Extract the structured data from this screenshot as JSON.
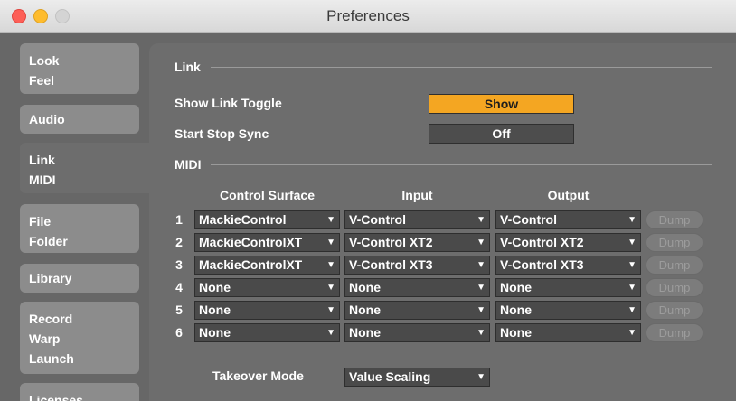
{
  "window": {
    "title": "Preferences"
  },
  "sidebar": {
    "items": [
      {
        "lines": [
          "Look",
          "Feel"
        ]
      },
      {
        "lines": [
          "Audio"
        ]
      },
      {
        "lines": [
          "Link",
          "MIDI"
        ],
        "active": true
      },
      {
        "lines": [
          "File",
          "Folder"
        ]
      },
      {
        "lines": [
          "Library"
        ]
      },
      {
        "lines": [
          "Record",
          "Warp",
          "Launch"
        ]
      },
      {
        "lines": [
          "Licenses"
        ]
      }
    ]
  },
  "link": {
    "title": "Link",
    "show_link_toggle": {
      "label": "Show Link Toggle",
      "value": "Show",
      "state": "on"
    },
    "start_stop_sync": {
      "label": "Start Stop Sync",
      "value": "Off",
      "state": "off"
    }
  },
  "midi": {
    "title": "MIDI",
    "headers": {
      "control_surface": "Control Surface",
      "input": "Input",
      "output": "Output"
    },
    "dump_label": "Dump",
    "rows": [
      {
        "num": "1",
        "control_surface": "MackieControl",
        "input": "V-Control",
        "output": "V-Control"
      },
      {
        "num": "2",
        "control_surface": "MackieControlXT",
        "input": "V-Control XT2",
        "output": "V-Control XT2"
      },
      {
        "num": "3",
        "control_surface": "MackieControlXT",
        "input": "V-Control XT3",
        "output": "V-Control XT3"
      },
      {
        "num": "4",
        "control_surface": "None",
        "input": "None",
        "output": "None"
      },
      {
        "num": "5",
        "control_surface": "None",
        "input": "None",
        "output": "None"
      },
      {
        "num": "6",
        "control_surface": "None",
        "input": "None",
        "output": "None"
      }
    ],
    "takeover": {
      "label": "Takeover Mode",
      "value": "Value Scaling"
    }
  },
  "colors": {
    "toggle_on": "#f4a622",
    "panel_bg": "#6d6d6d",
    "sidebar_item_bg": "#8c8c8c"
  },
  "icons": {
    "dropdown_arrow": "triangle-down-icon"
  }
}
